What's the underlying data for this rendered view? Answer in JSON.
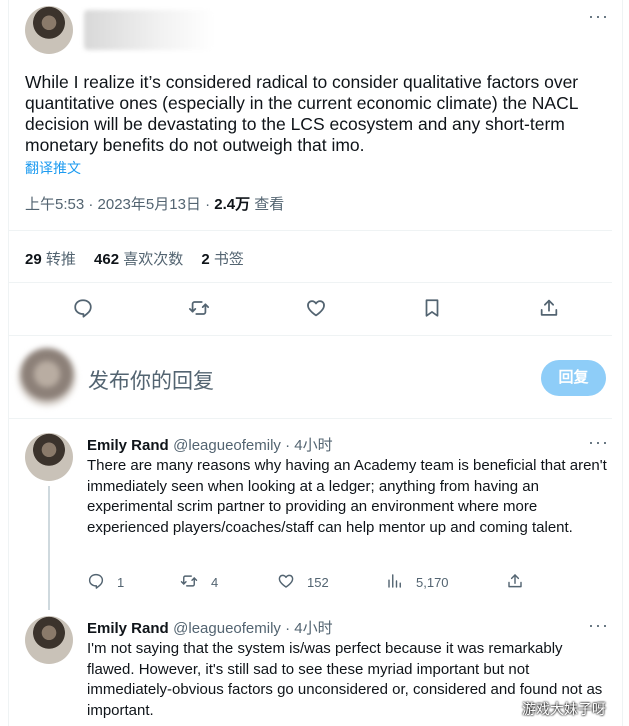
{
  "main_tweet": {
    "author_name": "Emily Rand",
    "text": "While I realize it’s considered radical to consider qualitative factors over quantitative ones (especially in the current economic climate) the NACL decision will be devastating to the LCS ecosystem and any short-term monetary benefits do not outweigh that imo.",
    "translate_label": "翻译推文",
    "time": "上午5:53 · 2023年5月13日 · ",
    "views_count": "2.4万",
    "views_label": " 查看",
    "stats": [
      {
        "count": "29",
        "label": " 转推"
      },
      {
        "count": "462",
        "label": " 喜欢次数"
      },
      {
        "count": "2",
        "label": " 书签"
      }
    ],
    "actions": [
      "reply-icon",
      "retweet-icon",
      "like-icon",
      "bookmark-icon",
      "share-icon"
    ]
  },
  "composer": {
    "placeholder": "发布你的回复",
    "button_label": "回复",
    "button_color": "#8ecdf8"
  },
  "replies": [
    {
      "name": "Emily Rand",
      "handle": "@leagueofemily",
      "time": " · 4小时",
      "text": "There are many reasons why having an Academy team is beneficial that aren't immediately seen when looking at a ledger; anything from having an experimental scrim partner to providing an environment where more experienced players/coaches/staff can help mentor up and coming talent.",
      "metrics": {
        "replies": "1",
        "retweets": "4",
        "likes": "152",
        "views": "5,170"
      }
    },
    {
      "name": "Emily Rand",
      "handle": "@leagueofemily",
      "time": " · 4小时",
      "text": "I'm not saying that the system is/was perfect because it was remarkably flawed. However, it's still sad to see these myriad important but not immediately-obvious factors go unconsidered or, considered and found not as important."
    }
  ],
  "watermark": "游戏大妹子呀",
  "more_label": "···"
}
